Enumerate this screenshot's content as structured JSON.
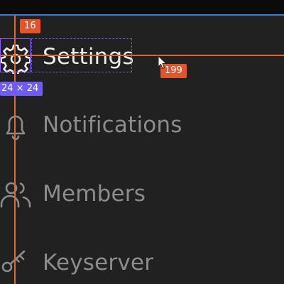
{
  "nav": {
    "items": [
      {
        "label": "Settings",
        "icon": "gear-icon",
        "active": true
      },
      {
        "label": "Notifications",
        "icon": "bell-icon",
        "active": false
      },
      {
        "label": "Members",
        "icon": "users-icon",
        "active": false
      },
      {
        "label": "Keyserver",
        "icon": "key-icon",
        "active": false
      }
    ]
  },
  "measure": {
    "spacing_label": "16",
    "distance_label": "199",
    "size_label": "24 × 24"
  },
  "colors": {
    "background": "#212121",
    "active_text": "#ececec",
    "inactive_text": "#8c8c8c",
    "guide": "#e0652e",
    "selection": "#8b5cf6",
    "accent_line": "#3d7bd9"
  }
}
